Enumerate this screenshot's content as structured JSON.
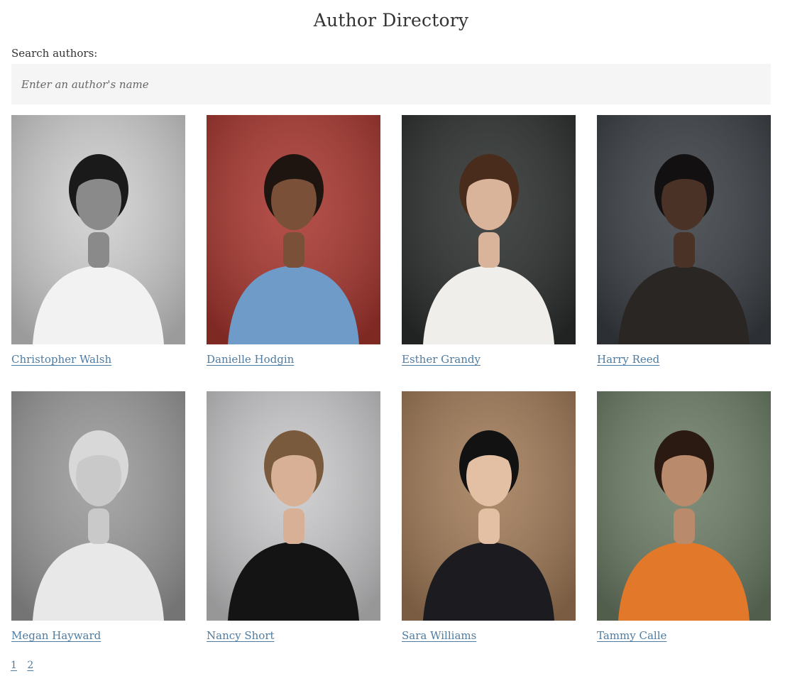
{
  "page": {
    "title": "Author Directory"
  },
  "search": {
    "label": "Search authors:",
    "placeholder": "Enter an author's name",
    "value": ""
  },
  "authors": [
    {
      "name": "Christopher Walsh",
      "photo_tone": "grayscale",
      "bg": "#cfcfcf",
      "shirt": "#f2f2f2",
      "skin": "#8a8a8a",
      "hair": "#1a1a1a"
    },
    {
      "name": "Danielle Hodgin",
      "photo_tone": "color",
      "bg": "#a9362f",
      "shirt": "#6f9bc8",
      "skin": "#7a5038",
      "hair": "#1e1410"
    },
    {
      "name": "Esther Grandy",
      "photo_tone": "color",
      "bg": "#2b2f2d",
      "shirt": "#f0eeea",
      "skin": "#d9b39a",
      "hair": "#4a2c1c"
    },
    {
      "name": "Harry Reed",
      "photo_tone": "color",
      "bg": "#3a3f44",
      "shirt": "#2a2624",
      "skin": "#4a3226",
      "hair": "#121010"
    },
    {
      "name": "Megan Hayward",
      "photo_tone": "grayscale",
      "bg": "#9a9a9a",
      "shirt": "#e8e8e8",
      "skin": "#c9c9c9",
      "hair": "#d8d8d8"
    },
    {
      "name": "Nancy Short",
      "photo_tone": "color",
      "bg": "#c9c9cb",
      "shirt": "#141414",
      "skin": "#d8b095",
      "hair": "#7a5a3c"
    },
    {
      "name": "Sara Williams",
      "photo_tone": "color",
      "bg": "#a17a57",
      "shirt": "#1c1c20",
      "skin": "#e3bfa3",
      "hair": "#121212"
    },
    {
      "name": "Tammy Calle",
      "photo_tone": "color",
      "bg": "#6c7d66",
      "shirt": "#e2782a",
      "skin": "#b98a6c",
      "hair": "#2a1a12"
    }
  ],
  "pagination": {
    "pages": [
      "1",
      "2"
    ]
  },
  "colors": {
    "link": "#4f7ba0",
    "input_bg": "#f5f5f5",
    "text": "#333333"
  }
}
